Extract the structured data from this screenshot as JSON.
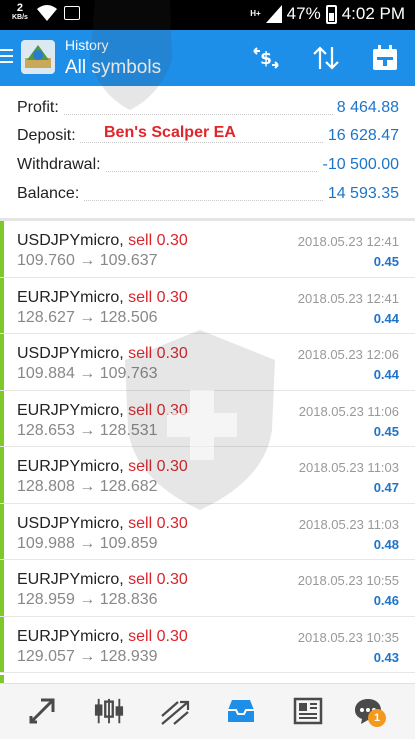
{
  "status_bar": {
    "speed": "2",
    "speed_unit": "KB/s",
    "network": "H+",
    "battery": "47%",
    "time": "4:02 PM"
  },
  "header": {
    "subtitle": "History",
    "title": "All symbols",
    "icons": [
      "menu-icon",
      "app-logo",
      "dollar-transfer-icon",
      "sort-icon",
      "calendar-icon"
    ]
  },
  "summary": {
    "profit_label": "Profit:",
    "profit_value": "8 464.88",
    "deposit_label": "Deposit:",
    "deposit_value": "16 628.47",
    "withdrawal_label": "Withdrawal:",
    "withdrawal_value": "-10 500.00",
    "balance_label": "Balance:",
    "balance_value": "14 593.35",
    "ea_note": "Ben's Scalper EA"
  },
  "deals": [
    {
      "symbol": "USDJPYmicro,",
      "side": "sell 0.30",
      "prices": "109.760 → 109.637",
      "time": "2018.05.23 12:41",
      "profit": "0.45"
    },
    {
      "symbol": "EURJPYmicro,",
      "side": "sell 0.30",
      "prices": "128.627 → 128.506",
      "time": "2018.05.23 12:41",
      "profit": "0.44"
    },
    {
      "symbol": "USDJPYmicro,",
      "side": "sell 0.30",
      "prices": "109.884 → 109.763",
      "time": "2018.05.23 12:06",
      "profit": "0.44"
    },
    {
      "symbol": "EURJPYmicro,",
      "side": "sell 0.30",
      "prices": "128.653 → 128.531",
      "time": "2018.05.23 11:06",
      "profit": "0.45"
    },
    {
      "symbol": "EURJPYmicro,",
      "side": "sell 0.30",
      "prices": "128.808 → 128.682",
      "time": "2018.05.23 11:03",
      "profit": "0.47"
    },
    {
      "symbol": "USDJPYmicro,",
      "side": "sell 0.30",
      "prices": "109.988 → 109.859",
      "time": "2018.05.23 11:03",
      "profit": "0.48"
    },
    {
      "symbol": "EURJPYmicro,",
      "side": "sell 0.30",
      "prices": "128.959 → 128.836",
      "time": "2018.05.23 10:55",
      "profit": "0.46"
    },
    {
      "symbol": "EURJPYmicro,",
      "side": "sell 0.30",
      "prices": "129.057 → 128.939",
      "time": "2018.05.23 10:35",
      "profit": "0.43"
    }
  ],
  "bottom_nav": {
    "items": [
      "quotes-icon",
      "chart-icon",
      "trade-icon",
      "history-icon",
      "news-icon",
      "chat-icon"
    ],
    "chat_badge": "1"
  },
  "colors": {
    "app_bar": "#1e8fe8",
    "value_blue": "#1e74c8",
    "sell_red": "#d8242b",
    "deal_bar_green": "#7ec82a",
    "badge_orange": "#f39a1e"
  }
}
